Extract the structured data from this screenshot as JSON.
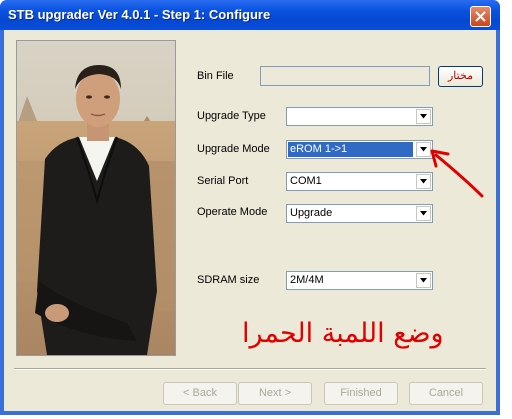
{
  "window": {
    "title": "STB upgrader Ver 4.0.1 - Step 1: Configure"
  },
  "form": {
    "bin_file_label": "Bin File",
    "bin_file_value": "",
    "browse_label": "مختار",
    "upgrade_type_label": "Upgrade Type",
    "upgrade_type_value": "",
    "upgrade_mode_label": "Upgrade Mode",
    "upgrade_mode_value": "eROM  1->1",
    "serial_port_label": "Serial Port",
    "serial_port_value": "COM1",
    "operate_mode_label": "Operate Mode",
    "operate_mode_value": "Upgrade",
    "sdram_label": "SDRAM size",
    "sdram_value": "2M/4M"
  },
  "annotation": {
    "text": "وضع اللمبة الحمرا",
    "color": "#e00000"
  },
  "buttons": {
    "back": "< Back",
    "next": "Next >",
    "finished": "Finished",
    "cancel": "Cancel"
  },
  "colors": {
    "titlebar": "#0a52df",
    "client": "#ece9d8",
    "selection": "#316ac5"
  }
}
